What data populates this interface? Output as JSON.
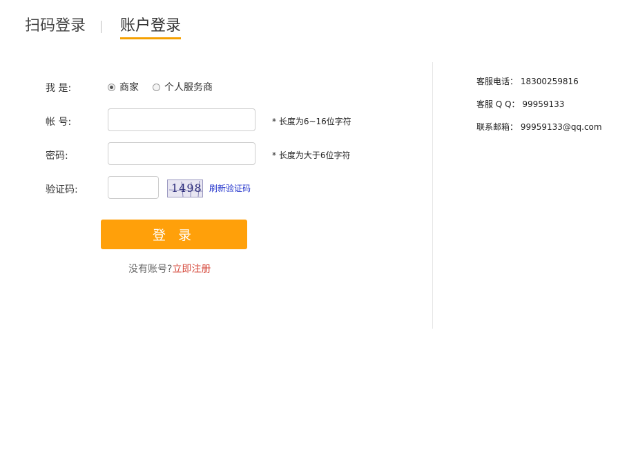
{
  "tabs": {
    "qr_login": "扫码登录",
    "account_login": "账户登录"
  },
  "form": {
    "role_label": "我 是:",
    "roles": [
      "商家",
      "个人服务商"
    ],
    "selected_role": "商家",
    "account_label": "帐 号:",
    "account_value": "",
    "account_hint": "* 长度为6~16位字符",
    "password_label": "密码:",
    "password_value": "",
    "password_hint": "* 长度为大于6位字符",
    "captcha_label": "验证码:",
    "captcha_value": "",
    "captcha_image_text": "1498",
    "refresh_captcha": "刷新验证码",
    "login_button": "登 录",
    "no_account": "没有账号?",
    "register_link": "立即注册"
  },
  "contact": {
    "phone": "客服电话： 18300259816",
    "qq": "客服 Q Q： 99959133",
    "email": "联系邮箱： 99959133@qq.com"
  },
  "colors": {
    "accent": "#ffa00a",
    "tab_underline": "#f5a000",
    "link_blue": "#2233cc",
    "register_red": "#d6483b"
  }
}
